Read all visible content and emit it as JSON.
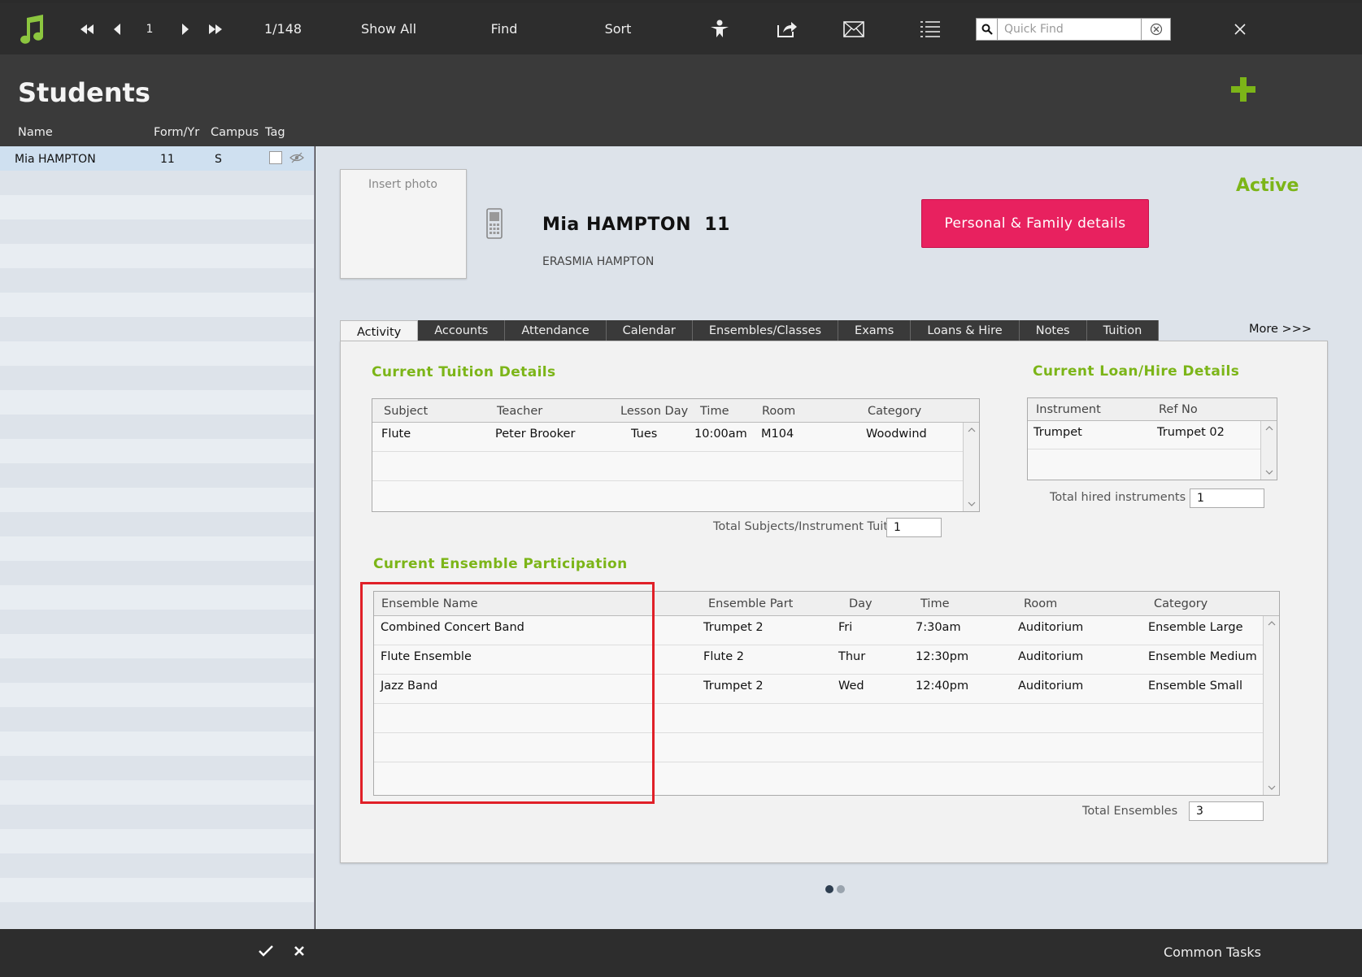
{
  "toolbar": {
    "record_number": "1",
    "record_count": "1/148",
    "show_all": "Show All",
    "find": "Find",
    "sort": "Sort",
    "quick_find_placeholder": "Quick Find"
  },
  "header": {
    "title": "Students",
    "columns": {
      "name": "Name",
      "form_yr": "Form/Yr",
      "campus": "Campus",
      "tag": "Tag"
    }
  },
  "list": {
    "selected": {
      "name": "Mia HAMPTON",
      "form_yr": "11",
      "campus": "S"
    }
  },
  "student": {
    "photo_placeholder": "Insert photo",
    "name": "Mia HAMPTON  11",
    "subtitle": "ERASMIA HAMPTON",
    "family_button": "Personal & Family details",
    "status": "Active"
  },
  "tabs": [
    "Activity",
    "Accounts",
    "Attendance",
    "Calendar",
    "Ensembles/Classes",
    "Exams",
    "Loans & Hire",
    "Notes",
    "Tuition"
  ],
  "more": "More >>>",
  "tuition": {
    "title": "Current Tuition Details",
    "headers": [
      "Subject",
      "Teacher",
      "Lesson Day",
      "Time",
      "Room",
      "Category"
    ],
    "rows": [
      [
        "Flute",
        "Peter Brooker",
        "Tues",
        "10:00am",
        "M104",
        "Woodwind"
      ]
    ],
    "total_label": "Total Subjects/Instrument Tuition",
    "total_value": "1"
  },
  "loans": {
    "title": "Current Loan/Hire Details",
    "headers": [
      "Instrument",
      "Ref No"
    ],
    "rows": [
      [
        "Trumpet",
        "Trumpet 02"
      ]
    ],
    "total_label": "Total hired instruments",
    "total_value": "1"
  },
  "ensembles": {
    "title": "Current Ensemble Participation",
    "headers": [
      "Ensemble Name",
      "Ensemble Part",
      "Day",
      "Time",
      "Room",
      "Category"
    ],
    "rows": [
      [
        "Combined Concert Band",
        "Trumpet 2",
        "Fri",
        "7:30am",
        "Auditorium",
        "Ensemble Large"
      ],
      [
        "Flute Ensemble",
        "Flute 2",
        "Thur",
        "12:30pm",
        "Auditorium",
        "Ensemble Medium"
      ],
      [
        "Jazz Band",
        "Trumpet 2",
        "Wed",
        "12:40pm",
        "Auditorium",
        "Ensemble Small"
      ]
    ],
    "total_label": "Total Ensembles",
    "total_value": "3"
  },
  "footer": {
    "common_tasks": "Common Tasks"
  },
  "colors": {
    "accent_green": "#7cb518",
    "button_pink": "#e8215f",
    "highlight_red": "#e02028"
  }
}
